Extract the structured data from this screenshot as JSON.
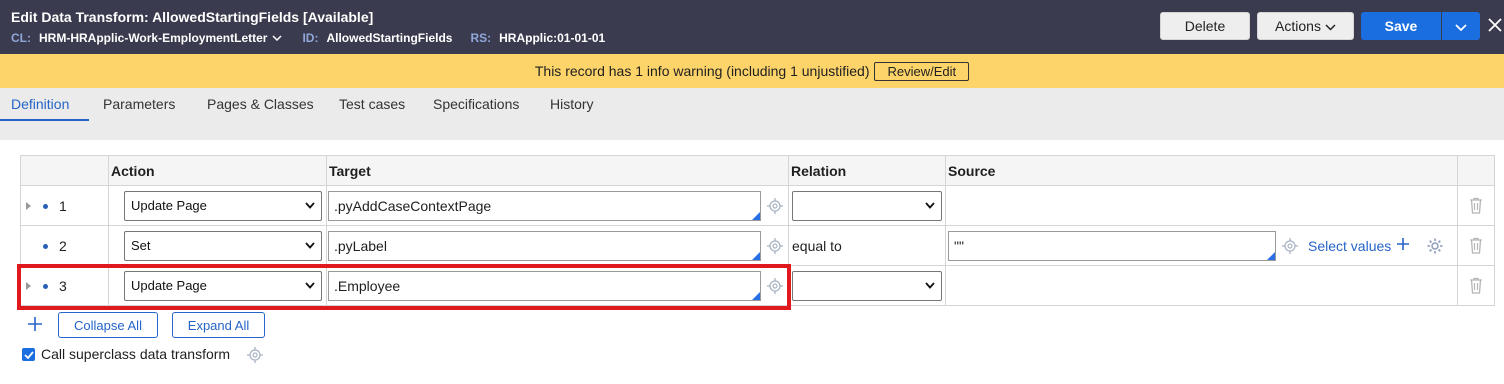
{
  "header": {
    "title_prefix": "Edit",
    "title": "Data Transform: AllowedStartingFields",
    "status": "[Available]",
    "cl_label": "CL:",
    "cl_value": "HRM-HRApplic-Work-EmploymentLetter",
    "id_label": "ID:",
    "id_value": "AllowedStartingFields",
    "rs_label": "RS:",
    "rs_value": "HRApplic:01-01-01",
    "delete_label": "Delete",
    "actions_label": "Actions",
    "save_label": "Save"
  },
  "warning": {
    "text": "This record has 1 info warning (including 1 unjustified)",
    "button_label": "Review/Edit"
  },
  "tabs": [
    {
      "label": "Definition",
      "active": true
    },
    {
      "label": "Parameters"
    },
    {
      "label": "Pages & Classes"
    },
    {
      "label": "Test cases"
    },
    {
      "label": "Specifications"
    },
    {
      "label": "History"
    }
  ],
  "grid": {
    "columns": [
      "",
      "Action",
      "Target",
      "Relation",
      "Source",
      ""
    ],
    "rows": [
      {
        "num": "1",
        "action": "Update Page",
        "target": ".pyAddCaseContextPage",
        "relation": "",
        "source": ""
      },
      {
        "num": "2",
        "action": "Set",
        "target": ".pyLabel",
        "relation": "equal to",
        "source": "\"\"",
        "select_values": "Select values"
      },
      {
        "num": "3",
        "action": "Update Page",
        "target": ".Employee",
        "relation": "",
        "source": ""
      }
    ]
  },
  "footer": {
    "collapse_all": "Collapse All",
    "expand_all": "Expand All",
    "superclass_label": "Call superclass data transform",
    "superclass_checked": true
  },
  "colors": {
    "header_bg": "#3b3b4f",
    "warning_bg": "#fdd46a",
    "accent": "#1a6ee0",
    "highlight": "#e0191e"
  }
}
